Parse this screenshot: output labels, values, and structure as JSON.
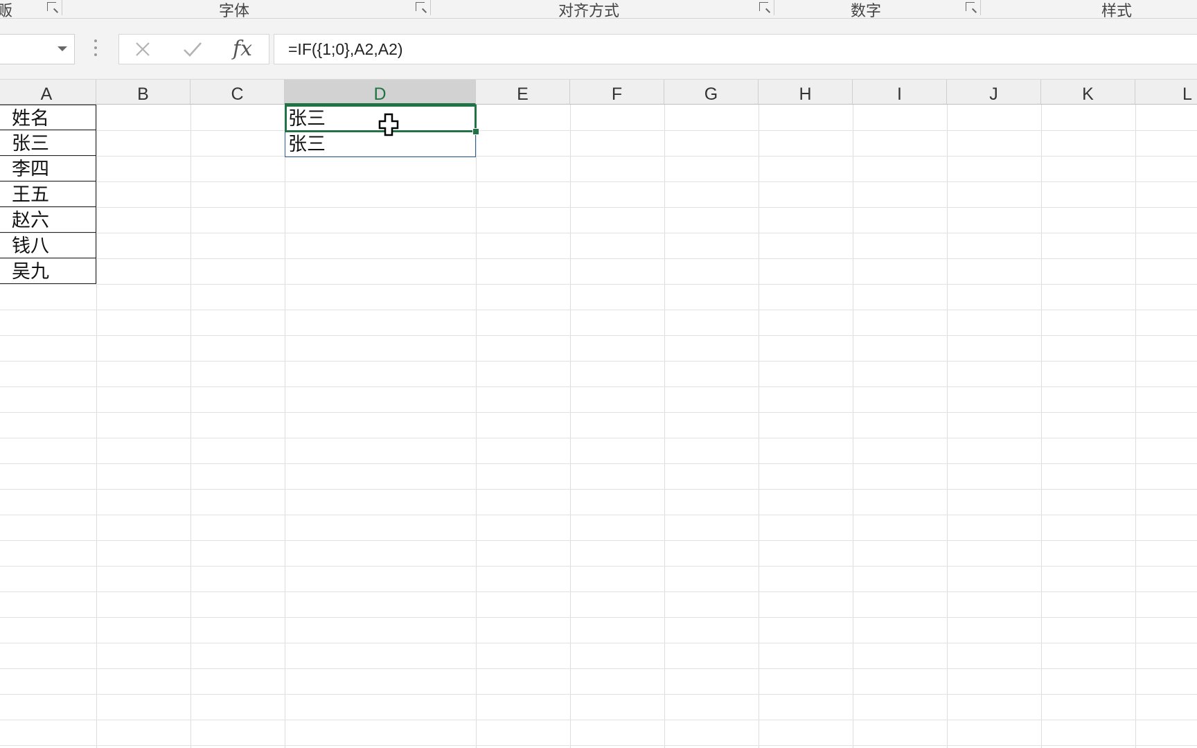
{
  "ribbon": {
    "groups": [
      {
        "label": "贩"
      },
      {
        "label": "字体"
      },
      {
        "label": "对齐方式"
      },
      {
        "label": "数字"
      },
      {
        "label": "样式"
      }
    ]
  },
  "formula_bar": {
    "name_box_value": "",
    "cancel_icon": "close-icon",
    "enter_icon": "check-icon",
    "fx_label": "fx",
    "formula": "=IF({1;0},A2,A2)"
  },
  "columns": [
    "A",
    "B",
    "C",
    "D",
    "E",
    "F",
    "G",
    "H",
    "I",
    "J",
    "K",
    "L"
  ],
  "active_column": "D",
  "column_a": [
    "姓名",
    "张三",
    "李四",
    "王五",
    "赵六",
    "钱八",
    "吴九"
  ],
  "column_d": [
    "张三",
    "张三"
  ],
  "accent_color": "#217346"
}
